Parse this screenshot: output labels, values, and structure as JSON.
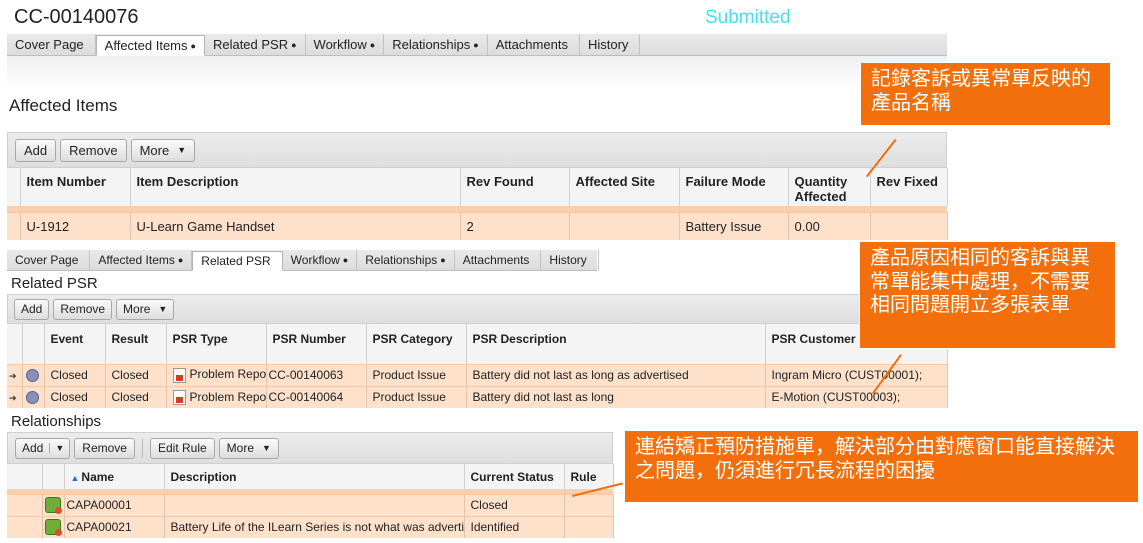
{
  "record_id": "CC-00140076",
  "status": "Submitted",
  "tabs_top": [
    {
      "label": "Cover Page",
      "dot": ""
    },
    {
      "label": "Affected Items",
      "dot": "●"
    },
    {
      "label": "Related PSR",
      "dot": "●"
    },
    {
      "label": "Workflow",
      "dot": "●"
    },
    {
      "label": "Relationships",
      "dot": "●"
    },
    {
      "label": "Attachments",
      "dot": ""
    },
    {
      "label": "History",
      "dot": ""
    }
  ],
  "affected": {
    "title": "Affected Items",
    "buttons": {
      "add": "Add",
      "remove": "Remove",
      "more": "More"
    },
    "columns": [
      "Item Number",
      "Item Description",
      "Rev Found",
      "Affected Site",
      "Failure Mode",
      "Quantity Affected",
      "Rev Fixed"
    ],
    "rows": [
      {
        "item_number": "U-1912",
        "item_description": "U-Learn Game Handset",
        "rev_found": "2",
        "affected_site": "",
        "failure_mode": "Battery Issue",
        "quantity": "0.00",
        "rev_fixed": ""
      }
    ]
  },
  "tabs_mid": [
    {
      "label": "Cover Page",
      "dot": ""
    },
    {
      "label": "Affected Items",
      "dot": "●"
    },
    {
      "label": "Related PSR",
      "dot": ""
    },
    {
      "label": "Workflow",
      "dot": "●"
    },
    {
      "label": "Relationships",
      "dot": "●"
    },
    {
      "label": "Attachments",
      "dot": ""
    },
    {
      "label": "History",
      "dot": ""
    }
  ],
  "psr": {
    "title": "Related PSR",
    "buttons": {
      "add": "Add",
      "remove": "Remove",
      "more": "More"
    },
    "columns": [
      "Event",
      "Result",
      "PSR Type",
      "PSR Number",
      "PSR Category",
      "PSR Description",
      "PSR Customer"
    ],
    "rows": [
      {
        "event": "Closed",
        "result": "Closed",
        "type": "Problem Repo",
        "number": "CC-00140063",
        "category": "Product Issue",
        "description": "Battery did not last as long as advertised",
        "customer": "Ingram Micro (CUST00001);"
      },
      {
        "event": "Closed",
        "result": "Closed",
        "type": "Problem Repo",
        "number": "CC-00140064",
        "category": "Product Issue",
        "description": "Battery did not last as long",
        "customer": "E-Motion (CUST00003);"
      }
    ]
  },
  "relationships": {
    "title": "Relationships",
    "buttons": {
      "add": "Add",
      "remove": "Remove",
      "edit_rule": "Edit Rule",
      "more": "More"
    },
    "columns": [
      "Name",
      "Description",
      "Current Status",
      "Rule"
    ],
    "rows": [
      {
        "name": "CAPA00001",
        "description": "",
        "status": "Closed",
        "rule": ""
      },
      {
        "name": "CAPA00021",
        "description": "Battery Life of the ILearn Series is not what was adverti",
        "status": "Identified",
        "rule": ""
      }
    ]
  },
  "callouts": [
    "記錄客訴或異常單反映的產品名稱",
    "產品原因相同的客訴與異常單能集中處理，不需要相同問題開立多張表單",
    "連結矯正預防措施單，解決部分由對應窗口能直接解決之問題，仍須進行冗長流程的困擾"
  ],
  "colors": {
    "status": "#3ee3ee",
    "callout": "#f26f0b",
    "row_highlight": "#fde1cb"
  }
}
